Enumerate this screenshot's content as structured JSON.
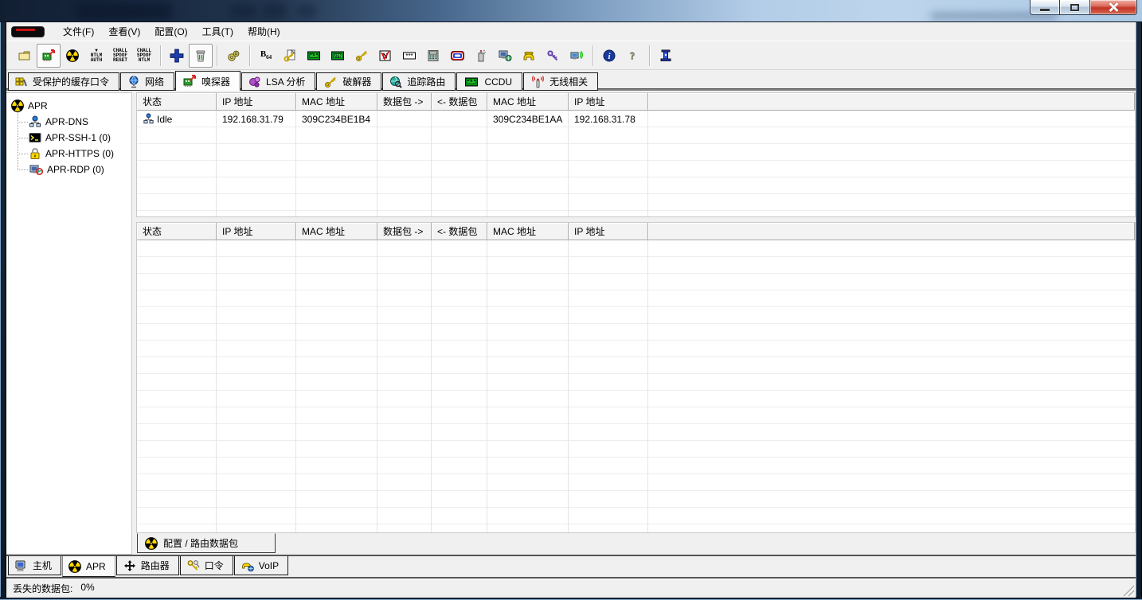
{
  "titlebar": {
    "controls": [
      {
        "name": "minimize-button"
      },
      {
        "name": "maximize-button"
      },
      {
        "name": "close-button"
      }
    ]
  },
  "menubar": {
    "items": [
      {
        "name": "menu-file",
        "label": "文件(F)"
      },
      {
        "name": "menu-view",
        "label": "查看(V)"
      },
      {
        "name": "menu-configure",
        "label": "配置(O)"
      },
      {
        "name": "menu-tools",
        "label": "工具(T)"
      },
      {
        "name": "menu-help",
        "label": "帮助(H)"
      }
    ]
  },
  "toolbar": {
    "buttons": [
      {
        "name": "open-file-button",
        "icon": "folder"
      },
      {
        "name": "start-stop-sniffer-button",
        "icon": "nic",
        "framed": true
      },
      {
        "name": "start-stop-apr-button",
        "icon": "radiation"
      },
      {
        "name": "ntlm-auth-button",
        "text": "▼\nNTLM\nAUTH"
      },
      {
        "name": "chall-spoof-reset-button",
        "text": "CHALL\nSPOOF\nRESET"
      },
      {
        "name": "chall-spoof-ntlm-button",
        "text": "CHALL\nSPOOF\nNTLM"
      },
      {
        "sep": true
      },
      {
        "name": "add-to-list-button",
        "icon": "plus"
      },
      {
        "name": "remove-button",
        "icon": "trash",
        "framed": true
      },
      {
        "sep": true
      },
      {
        "name": "configure-button",
        "icon": "gears"
      },
      {
        "sep": true
      },
      {
        "name": "base64-decoder-button",
        "icon": "b64"
      },
      {
        "name": "access-db-decoder-button",
        "icon": "keypage"
      },
      {
        "name": "cisco-type7-decoder-button",
        "icon": "lcd7"
      },
      {
        "name": "cisco-vpn-decoder-button",
        "icon": "lcdvpn"
      },
      {
        "name": "enterprise-manager-decoder-button",
        "icon": "keygold"
      },
      {
        "name": "vnc-decoder-button",
        "icon": "vnc"
      },
      {
        "name": "password-reveal-button",
        "icon": "stars"
      },
      {
        "name": "hash-calculator-button",
        "icon": "calc"
      },
      {
        "name": "rdp-decoder-button",
        "icon": "rdpbox"
      },
      {
        "name": "syskey-button",
        "icon": "spray"
      },
      {
        "name": "network-connections-button",
        "icon": "netmon"
      },
      {
        "name": "dialup-decoder-button",
        "icon": "phone"
      },
      {
        "name": "wireless-key-button",
        "icon": "keypurple"
      },
      {
        "name": "wireless-zero-button",
        "icon": "monwifi"
      },
      {
        "sep": true
      },
      {
        "name": "about-button",
        "icon": "info"
      },
      {
        "name": "help-button",
        "icon": "question"
      },
      {
        "sep": true
      },
      {
        "name": "exit-button",
        "icon": "exitcol"
      }
    ]
  },
  "top_tabs": [
    {
      "name": "tab-protected-storage",
      "label": "受保护的缓存口令",
      "icon": "decodergrid",
      "active": false
    },
    {
      "name": "tab-network",
      "label": "网络",
      "icon": "globestand",
      "active": false
    },
    {
      "name": "tab-sniffer",
      "label": "嗅探器",
      "icon": "nic",
      "active": true
    },
    {
      "name": "tab-lsa-secrets",
      "label": "LSA 分析",
      "icon": "lsa",
      "active": false
    },
    {
      "name": "tab-cracker",
      "label": "破解器",
      "icon": "keygold",
      "active": false
    },
    {
      "name": "tab-traceroute",
      "label": "追踪路由",
      "icon": "traceglobe",
      "active": false
    },
    {
      "name": "tab-ccdu",
      "label": "CCDU",
      "icon": "lcd7",
      "active": false
    },
    {
      "name": "tab-wireless",
      "label": "无线相关",
      "icon": "antenna",
      "active": false
    }
  ],
  "tree": {
    "root": {
      "name": "tree-item-apr",
      "label": "APR",
      "icon": "radiation"
    },
    "children": [
      {
        "name": "tree-item-apr-dns",
        "label": "APR-DNS",
        "icon": "network"
      },
      {
        "name": "tree-item-apr-ssh",
        "label": "APR-SSH-1 (0)",
        "icon": "terminal"
      },
      {
        "name": "tree-item-apr-https",
        "label": "APR-HTTPS (0)",
        "icon": "padlock"
      },
      {
        "name": "tree-item-apr-rdp",
        "label": "APR-RDP (0)",
        "icon": "monnet"
      }
    ]
  },
  "tables": {
    "columns": [
      "状态",
      "IP 地址",
      "MAC 地址",
      "数据包 ->",
      "<- 数据包",
      "MAC 地址",
      "IP 地址"
    ],
    "top_rows": [
      {
        "icon": "hostnet",
        "cells": [
          "Idle",
          "192.168.31.79",
          "309C234BE1B4",
          "",
          "",
          "309C234BE1AA",
          "192.168.31.78"
        ]
      }
    ],
    "bottom_rows": []
  },
  "inner_tab": {
    "name": "tab-configuration-routed-packets",
    "label": "配置 / 路由数据包",
    "icon": "radiation"
  },
  "bottom_tabs": [
    {
      "name": "tab-hosts",
      "label": "主机",
      "icon": "computer",
      "active": false
    },
    {
      "name": "tab-apr",
      "label": "APR",
      "icon": "radiation",
      "active": true
    },
    {
      "name": "tab-routing",
      "label": "路由器",
      "icon": "movearrows",
      "active": false
    },
    {
      "name": "tab-passwords",
      "label": "口令",
      "icon": "keyspair",
      "active": false
    },
    {
      "name": "tab-voip",
      "label": "VoIP",
      "icon": "voipphone",
      "active": false
    }
  ],
  "statusbar": {
    "lost_packets_label": "丢失的数据包:",
    "lost_packets_value": "0%"
  }
}
